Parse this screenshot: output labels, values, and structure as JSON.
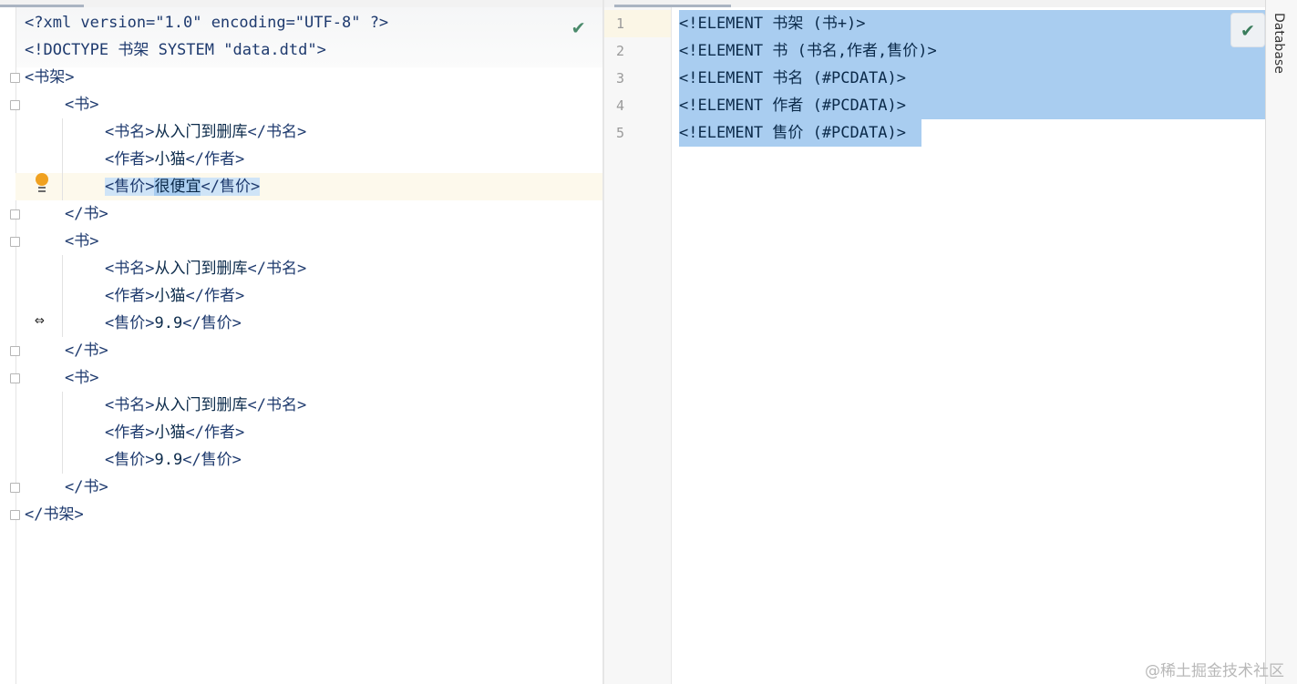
{
  "left_editor": {
    "lines": [
      {
        "prefix": "<?xml version=\"1.0\" encoding=\"UTF-8\" ?>",
        "text": "",
        "suffix": ""
      },
      {
        "prefix": "<!DOCTYPE 书架 SYSTEM \"data.dtd\">",
        "text": "",
        "suffix": ""
      },
      {
        "prefix": "<书架>",
        "text": "",
        "suffix": ""
      },
      {
        "prefix": "<书>",
        "text": "",
        "suffix": ""
      },
      {
        "prefix": "<书名>",
        "text": "从入门到删库",
        "suffix": "</书名>"
      },
      {
        "prefix": "<作者>",
        "text": "小猫",
        "suffix": "</作者>"
      },
      {
        "prefix": "<售价>",
        "text": "很便宜",
        "suffix": "</售价>"
      },
      {
        "prefix": "</书>",
        "text": "",
        "suffix": ""
      },
      {
        "prefix": "<书>",
        "text": "",
        "suffix": ""
      },
      {
        "prefix": "<书名>",
        "text": "从入门到删库",
        "suffix": "</书名>"
      },
      {
        "prefix": "<作者>",
        "text": "小猫",
        "suffix": "</作者>"
      },
      {
        "prefix": "<售价>",
        "text": "9.9",
        "suffix": "</售价>"
      },
      {
        "prefix": "</书>",
        "text": "",
        "suffix": ""
      },
      {
        "prefix": "<书>",
        "text": "",
        "suffix": ""
      },
      {
        "prefix": "<书名>",
        "text": "从入门到删库",
        "suffix": "</书名>"
      },
      {
        "prefix": "<作者>",
        "text": "小猫",
        "suffix": "</作者>"
      },
      {
        "prefix": "<售价>",
        "text": "9.9",
        "suffix": "</售价>"
      },
      {
        "prefix": "</书>",
        "text": "",
        "suffix": ""
      },
      {
        "prefix": "</书架>",
        "text": "",
        "suffix": ""
      }
    ],
    "selected_line": 7,
    "inspection_status_icon": "checkmark-icon",
    "intention_icon": "lightbulb-icon",
    "cursor_icon": "horizontal-resize-cursor-icon"
  },
  "right_editor": {
    "line_numbers": [
      "1",
      "2",
      "3",
      "4",
      "5"
    ],
    "lines": [
      "<!ELEMENT 书架 (书+)>",
      "<!ELEMENT 书 (书名,作者,售价)>",
      "<!ELEMENT 书名 (#PCDATA)>",
      "<!ELEMENT 作者 (#PCDATA)>",
      "<!ELEMENT 售价 (#PCDATA)>"
    ],
    "inspection_status_icon": "checkmark-icon"
  },
  "side_tool_window": {
    "label": "Database"
  },
  "watermark": "@稀土掘金技术社区",
  "colors": {
    "selection": "#a9cdf0",
    "tag": "#1e3a6e",
    "current_line": "#fdf9ec",
    "bulb": "#f0a120"
  }
}
